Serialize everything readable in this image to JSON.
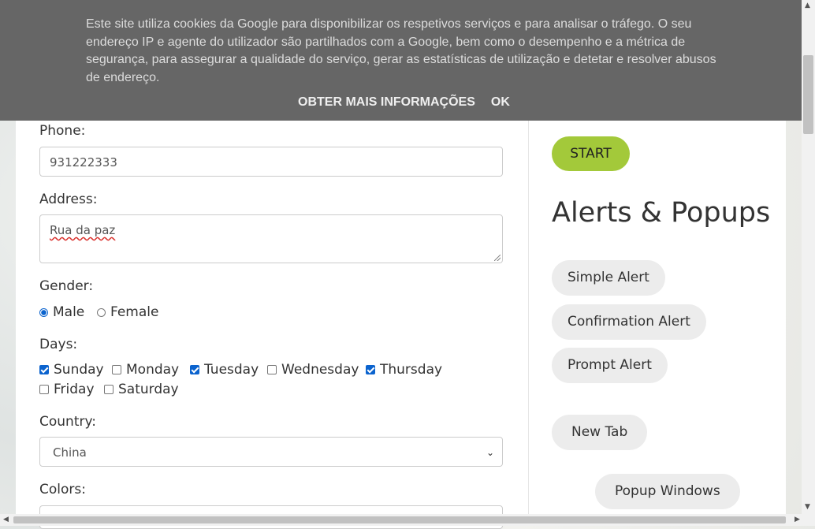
{
  "cookie_banner": {
    "text": "Este site utiliza cookies da Google para disponibilizar os respetivos serviços e para analisar o tráfego. O seu endereço IP e agente do utilizador são partilhados com a Google, bem como o desempenho e a métrica de segurança, para assegurar a qualidade do serviço, gerar as estatísticas de utilização e detetar e resolver abusos de endereço.",
    "more_info_label": "OBTER MAIS INFORMAÇÕES",
    "ok_label": "OK"
  },
  "form": {
    "phone_label": "Phone:",
    "phone_value": "931222333",
    "address_label": "Address:",
    "address_value": "Rua da paz",
    "gender_label": "Gender:",
    "gender_options": [
      "Male",
      "Female"
    ],
    "gender_selected": "Male",
    "days_label": "Days:",
    "days": [
      {
        "label": "Sunday",
        "checked": true
      },
      {
        "label": "Monday",
        "checked": false
      },
      {
        "label": "Tuesday",
        "checked": true
      },
      {
        "label": "Wednesday",
        "checked": false
      },
      {
        "label": "Thursday",
        "checked": true
      },
      {
        "label": "Friday",
        "checked": false
      },
      {
        "label": "Saturday",
        "checked": false
      }
    ],
    "country_label": "Country:",
    "country_value": "China",
    "colors_label": "Colors:"
  },
  "sidebar": {
    "start_label": "START",
    "section_title": "Alerts & Popups",
    "simple_alert_label": "Simple Alert",
    "confirmation_alert_label": "Confirmation Alert",
    "prompt_alert_label": "Prompt Alert",
    "new_tab_label": "New Tab",
    "popup_windows_label": "Popup Windows"
  },
  "colors": {
    "accent_green": "#a3c93a",
    "cookie_bg": "#666666",
    "pill_bg": "#ececec",
    "checkbox_blue": "#0b63ce"
  }
}
